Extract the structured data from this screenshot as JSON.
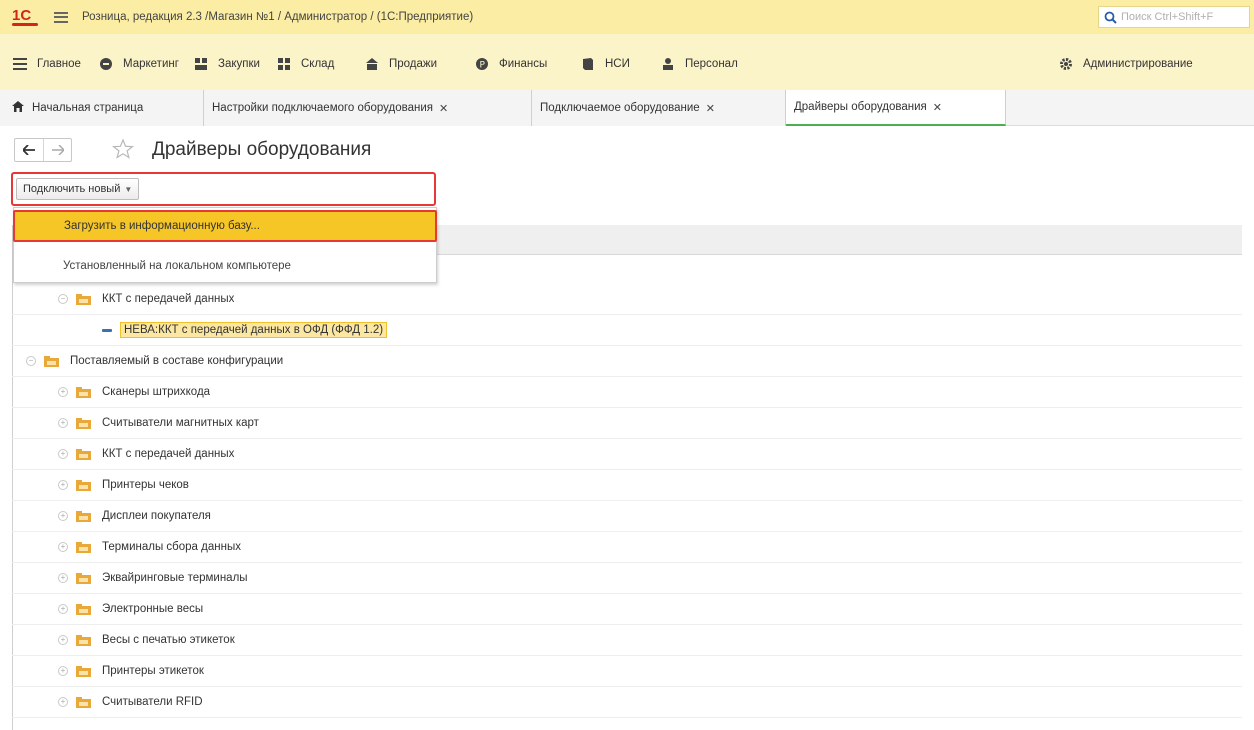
{
  "app": {
    "title": "Розница, редакция 2.3 /Магазин №1 / Администратор /  (1С:Предприятие)",
    "search_placeholder": "Поиск Ctrl+Shift+F"
  },
  "sections": [
    {
      "label": "Главное",
      "icon": "menu-lines-icon"
    },
    {
      "label": "Маркетинг",
      "icon": "badge-icon"
    },
    {
      "label": "Закупки",
      "icon": "purchases-icon"
    },
    {
      "label": "Склад",
      "icon": "warehouse-icon"
    },
    {
      "label": "Продажи",
      "icon": "sales-icon"
    },
    {
      "label": "Финансы",
      "icon": "finance-icon"
    },
    {
      "label": "НСИ",
      "icon": "book-icon"
    },
    {
      "label": "Персонал",
      "icon": "person-icon"
    },
    {
      "label": "Администрирование",
      "icon": "gear-icon"
    }
  ],
  "tabs": [
    {
      "label": "Начальная страница",
      "icon": "home-icon",
      "closable": false
    },
    {
      "label": "Настройки подключаемого оборудования",
      "closable": true
    },
    {
      "label": "Подключаемое оборудование",
      "closable": true
    },
    {
      "label": "Драйверы оборудования",
      "closable": true,
      "active": true
    }
  ],
  "page": {
    "title": "Драйверы оборудования",
    "command_button": "Подключить новый",
    "dropdown": [
      "Загрузить в информационную базу...",
      "Установленный на локальном компьютере"
    ]
  },
  "tree": [
    {
      "label": "ККТ с передачей данных",
      "level": 1,
      "type": "folder",
      "expanded": true
    },
    {
      "label": "НЕВА:ККТ с передачей данных в ОФД (ФФД 1.2)",
      "level": 2,
      "type": "item",
      "highlighted": true
    },
    {
      "label": "Поставляемый в составе конфигурации",
      "level": 0,
      "type": "folder",
      "expanded": true
    },
    {
      "label": "Сканеры штрихкода",
      "level": 1,
      "type": "folder"
    },
    {
      "label": "Считыватели магнитных карт",
      "level": 1,
      "type": "folder"
    },
    {
      "label": "ККТ с передачей данных",
      "level": 1,
      "type": "folder"
    },
    {
      "label": "Принтеры чеков",
      "level": 1,
      "type": "folder"
    },
    {
      "label": "Дисплеи покупателя",
      "level": 1,
      "type": "folder"
    },
    {
      "label": "Терминалы сбора данных",
      "level": 1,
      "type": "folder"
    },
    {
      "label": "Эквайринговые терминалы",
      "level": 1,
      "type": "folder"
    },
    {
      "label": "Электронные весы",
      "level": 1,
      "type": "folder"
    },
    {
      "label": "Весы с печатью этикеток",
      "level": 1,
      "type": "folder"
    },
    {
      "label": "Принтеры этикеток",
      "level": 1,
      "type": "folder"
    },
    {
      "label": "Считыватели RFID",
      "level": 1,
      "type": "folder"
    }
  ],
  "colors": {
    "titlebar": "#fbeda3",
    "menubar": "#fcf4c9",
    "selection": "#f6c526",
    "highlight_border": "#e53935",
    "active_tab_underline": "#4caf50"
  }
}
